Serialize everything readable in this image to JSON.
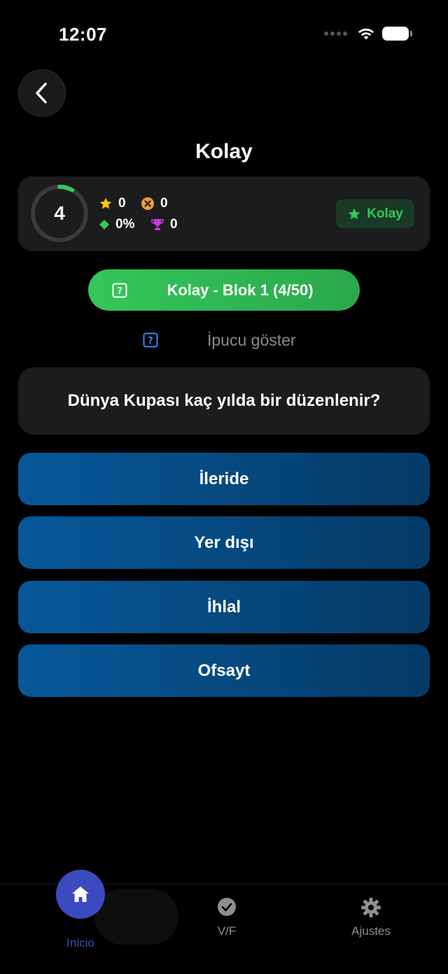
{
  "status_bar": {
    "time": "12:07"
  },
  "header": {
    "title": "Kolay",
    "back_icon": "chevron-left-icon"
  },
  "stats": {
    "progress_number": "4",
    "progress_fraction": 0.08,
    "stars": "0",
    "wrong": "0",
    "accuracy": "0%",
    "trophies": "0",
    "level_badge": "Kolay",
    "colors": {
      "ring_track": "#3a3a3c",
      "ring_progress": "#34c759",
      "star": "#ffcc00",
      "wrong": "#f09a37",
      "accuracy": "#34c759",
      "trophy": "#c739e8"
    }
  },
  "block_button": {
    "label": "Kolay - Blok 1 (4/50)"
  },
  "hint": {
    "label": "İpucu göster"
  },
  "question": {
    "text": "Dünya Kupası kaç yılda bir düzenlenir?"
  },
  "answers": [
    {
      "label": "İleride"
    },
    {
      "label": "Yer dışı"
    },
    {
      "label": "İhlal"
    },
    {
      "label": "Ofsayt"
    }
  ],
  "tabbar": {
    "tabs": [
      {
        "label": "Inicio",
        "icon": "home-icon",
        "active": true
      },
      {
        "label": "V/F",
        "icon": "checkmark-circle-icon",
        "active": false
      },
      {
        "label": "Ajustes",
        "icon": "gear-icon",
        "active": false
      }
    ],
    "active_color": "#3b4bbf",
    "inactive_color": "#8e8e93"
  }
}
